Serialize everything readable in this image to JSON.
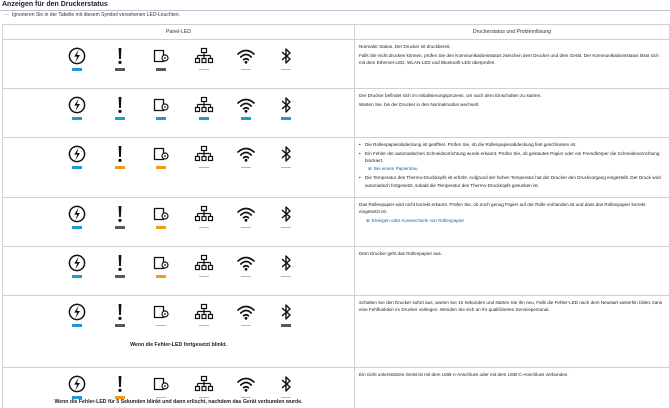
{
  "page": {
    "title": "Anzeigen für den Druckerstatus",
    "note": "Ignorieren Sie in der Tabelle mit diesem Symbol versehenen LED-Leuchten."
  },
  "table": {
    "col_led": "Panel-LED",
    "col_status": "Druckerstatus und Problemlösung",
    "rows": [
      {
        "leds": [
          "blue",
          "gray",
          "gray",
          "off",
          "off",
          "off"
        ],
        "paras": [
          "Normaler Status. Der Drucker ist druckbereit.",
          "Falls Sie nicht drucken können, prüfen Sie den Kommunikationsstatus zwischen dem Drucker und dem Gerät. Der Kommunikationsstatus lässt sich mit dem Ethernet-LED, WLAN-LED und Bluetooth-LED überprüfen."
        ]
      },
      {
        "leds": [
          "blue",
          "blue",
          "blue",
          "blue",
          "blue",
          "blue"
        ],
        "paras": [
          "Der Drucker befindet sich im Initialisierungsprozess, um nach dem Einschalten zu starten.",
          "Warten Sie, bis der Drucker in den Normalmodus wechselt."
        ]
      },
      {
        "leds": [
          "blue",
          "orange",
          "orange",
          "off",
          "off",
          "off"
        ],
        "bullets": [
          "Die Rollenpapierabdeckung ist geöffnet. Prüfen Sie, ob die Rollenpapierabdeckung fest geschlossen ist.",
          "Ein Fehler der automatischen Schneidvorrichtung wurde erkannt. Prüfen Sie, ob gestautes Papier oder ein Fremdkörper die Schneidevorrichtung blockiert.",
          "Die Temperatur des Thermo-Druckkopfs ist erhöht. Aufgrund der hohen Temperatur hat der Drucker den Druckvorgang eingestellt. Der Druck wird automatisch fortgesetzt, sobald die Temperatur des Thermo-Druckkopfs gesunken ist."
        ],
        "bullet_link": "Bei einem Papierstau",
        "bullet_link_index": 1
      },
      {
        "leds": [
          "blue",
          "gray",
          "orange",
          "off",
          "off",
          "off"
        ],
        "paras": [
          "Das Rollenpapier wird nicht korrekt erkannt. Prüfen Sie, ob noch genug Papier auf der Rolle vorhanden ist und dass das Rollenpapier korrekt eingesetzt ist."
        ],
        "link": "Einlegen oder Auswechseln von Rollenpapier"
      },
      {
        "leds": [
          "blue",
          "gray",
          "orange",
          "off",
          "off",
          "off"
        ],
        "paras": [
          "Dem Drucker geht das Rollenpapier aus."
        ]
      },
      {
        "leds": [
          "blue",
          "gray",
          "off",
          "off",
          "off",
          "gray"
        ],
        "caption": "Wenn die Fehler-LED fortgesetzt blinkt.",
        "paras": [
          "Schalten Sie den Drucker sofort aus, warten Sie 10 Sekunden und starten Sie ihn neu. Falls die Fehler-LED nach dem Neustart weiterhin blinkt, kann eine Fehlfunktion im Drucker vorliegen. Wenden Sie sich an Ihr qualifiziertes Servicepersonal."
        ]
      },
      {
        "leds": [
          "blue",
          "orange",
          "off",
          "off",
          "off",
          "off"
        ],
        "blinking_led": 1,
        "caption": "Wenn die Fehler-LED für 5 Sekunden blinkt und dann erlischt, nachdem das Gerät verbunden wurde.",
        "paras": [
          "Ein nicht unterstütztes Gerät ist mit dem USB-A-Anschluss oder mit dem USB-C-Anschluss verbunden."
        ]
      }
    ]
  },
  "icons": [
    "power-icon",
    "error-icon",
    "paper-icon",
    "ethernet-icon",
    "wifi-icon",
    "bluetooth-icon"
  ],
  "colors": {
    "blue": "#1e9ad6",
    "gray": "#595959",
    "orange": "#f39a1e",
    "off": "#b8b8b8",
    "link": "#1f5fa8"
  }
}
